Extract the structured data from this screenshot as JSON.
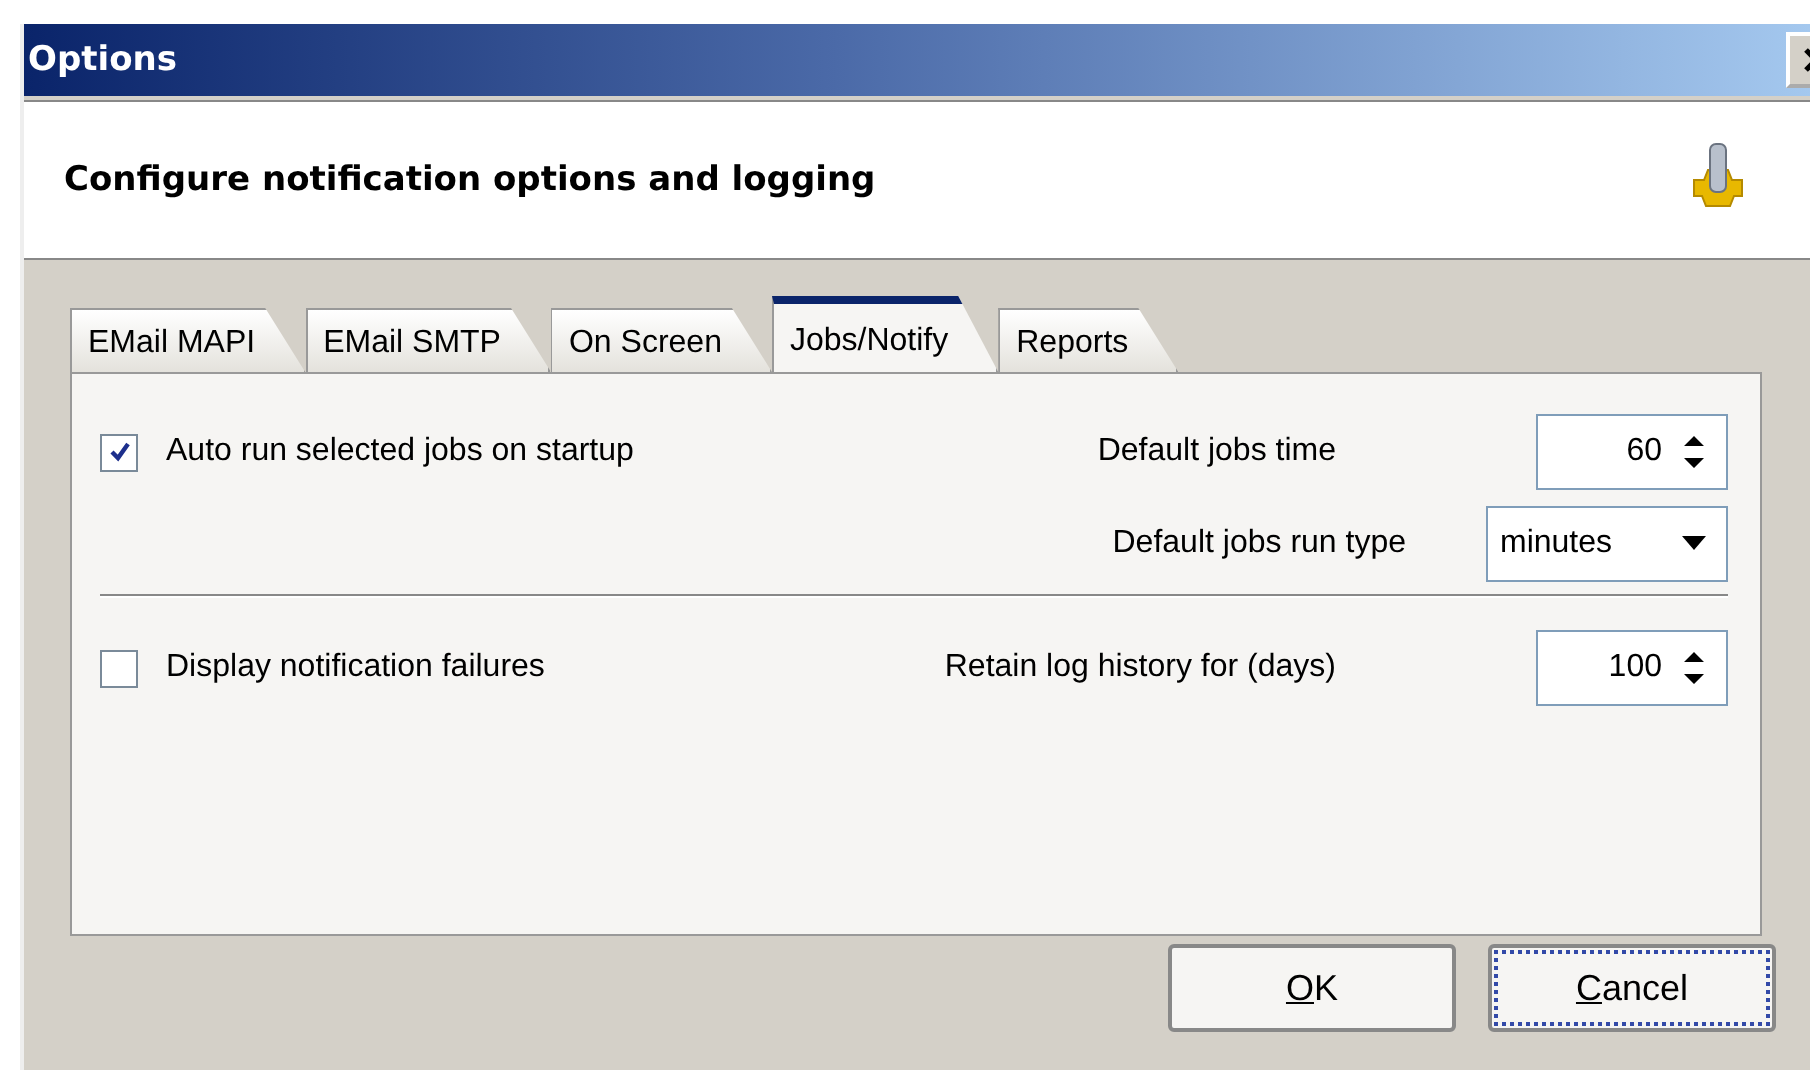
{
  "window": {
    "title": "Options"
  },
  "header": {
    "text": "Configure notification options and logging"
  },
  "tabs": [
    {
      "label": "EMail MAPI",
      "selected": false
    },
    {
      "label": "EMail SMTP",
      "selected": false
    },
    {
      "label": "On Screen",
      "selected": false
    },
    {
      "label": "Jobs/Notify",
      "selected": true
    },
    {
      "label": "Reports",
      "selected": false
    }
  ],
  "sections": [
    {
      "checkbox": {
        "label": "Auto run selected jobs on startup",
        "checked": true
      },
      "fields": [
        {
          "kind": "spin",
          "label": "Default jobs time",
          "value": "60"
        },
        {
          "kind": "combo",
          "label": "Default jobs run type",
          "value": "minutes"
        }
      ]
    },
    {
      "checkbox": {
        "label": "Display notification failures",
        "checked": false
      },
      "fields": [
        {
          "kind": "spin",
          "label": "Retain log history for (days)",
          "value": "100"
        }
      ]
    }
  ],
  "buttons": [
    {
      "key": "O",
      "rest": "K",
      "focused": false
    },
    {
      "key": "C",
      "rest": "ancel",
      "focused": true
    }
  ]
}
